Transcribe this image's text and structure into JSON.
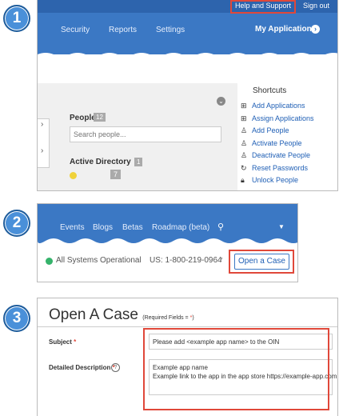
{
  "steps": [
    "1",
    "2",
    "3"
  ],
  "panel1": {
    "topbar": {
      "help": "Help and Support",
      "signout": "Sign out"
    },
    "nav": {
      "security": "Security",
      "reports": "Reports",
      "settings": "Settings",
      "my_apps": "My Applications"
    },
    "people": {
      "label": "People",
      "count": "12",
      "search_placeholder": "Search people..."
    },
    "ad": {
      "label": "Active Directory",
      "count": "1",
      "badge": "7"
    },
    "shortcuts": {
      "title": "Shortcuts",
      "items": [
        {
          "label": "Add Applications",
          "icon": "grid-plus-icon"
        },
        {
          "label": "Assign Applications",
          "icon": "grid-assign-icon"
        },
        {
          "label": "Add People",
          "icon": "person-add-icon"
        },
        {
          "label": "Activate People",
          "icon": "person-activate-icon"
        },
        {
          "label": "Deactivate People",
          "icon": "person-deactivate-icon"
        },
        {
          "label": "Reset Passwords",
          "icon": "refresh-icon"
        },
        {
          "label": "Unlock People",
          "icon": "lock-icon"
        }
      ]
    }
  },
  "panel2": {
    "nav": {
      "events": "Events",
      "blogs": "Blogs",
      "betas": "Betas",
      "roadmap": "Roadmap (beta)"
    },
    "status": "All Systems Operational",
    "phone": "US: 1-800-219-0964",
    "open_case": "Open a Case"
  },
  "panel3": {
    "title": "Open A Case",
    "required_note": "(Required Fields = ",
    "required_star": "*",
    "required_close": ")",
    "subject_label": "Subject",
    "subject_value": "Please add <example app name> to the OIN",
    "desc_label": "Detailed Description",
    "desc_line1": "Example app name",
    "desc_line2": "Example link to the app in the app store https://example-app.com"
  },
  "colors": {
    "nav_blue": "#3b78c4",
    "accent_red": "#e0483a",
    "step_blue": "#4a90d9",
    "link_blue": "#1f5fb5",
    "status_green": "#35b36b"
  }
}
